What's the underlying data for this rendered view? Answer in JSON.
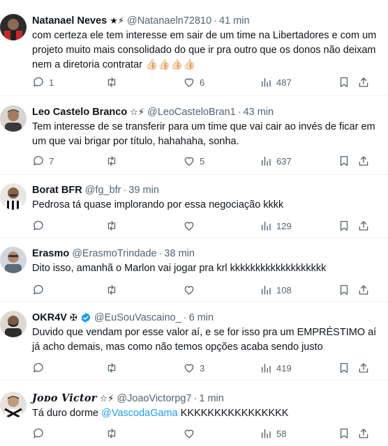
{
  "tweets": [
    {
      "name": "Natanael Neves",
      "decor": "★⚡",
      "handle": "@Natanaeln72810",
      "sep": "·",
      "time": "41 min",
      "text": "com certeza ele tem interesse em sair de um time na Libertadores e com um projeto muito mais consolidado do que ir pra outro que os donos não deixam nem a diretoria contratar 👍🏻👍🏻👍🏻👍🏻",
      "replies": "1",
      "retweets": "",
      "likes": "6",
      "views": "487"
    },
    {
      "name": "Leo Castelo Branco",
      "decor": "☆⚡",
      "handle": "@LeoCasteloBran1",
      "sep": "·",
      "time": "43 min",
      "text": "Tem interesse de se transferir para um time que vai cair ao invés de ficar em um que vai brigar por título, hahahaha, sonha.",
      "replies": "7",
      "retweets": "",
      "likes": "5",
      "views": "637"
    },
    {
      "name": "Borat BFR",
      "decor": "",
      "handle": "@fg_bfr",
      "sep": "·",
      "time": "39 min",
      "text": "Pedrosa tá quase implorando por essa negociação kkkk",
      "replies": "",
      "retweets": "",
      "likes": "",
      "views": "129"
    },
    {
      "name": "Erasmo",
      "decor": "",
      "handle": "@ErasmoTrindade",
      "sep": "·",
      "time": "38 min",
      "text": "Dito isso, amanhã o Marlon vai jogar pra krl kkkkkkkkkkkkkkkkkkk",
      "replies": "",
      "retweets": "",
      "likes": "",
      "views": "108"
    },
    {
      "name": "OKR4V",
      "decor": "✠",
      "handle": "@EuSouVascaino_",
      "sep": "·",
      "time": "6 min",
      "text": "Duvido que vendam por esse valor aí, e se for isso pra um EMPRÉSTIMO aí já acho demais, mas como não temos opções acaba sendo justo",
      "replies": "",
      "retweets": "",
      "likes": "3",
      "views": "419"
    },
    {
      "name": "Joᴅo Victor",
      "decor": "☆⚡",
      "handle": "@JoaoVictorpg7",
      "sep": "·",
      "time": "1 min",
      "text_before": "Tá duro dorme ",
      "mention": "@VascodaGama",
      "text_after": " KKKKKKKKKKKKKKKK",
      "replies": "",
      "retweets": "",
      "likes": "",
      "views": "58"
    }
  ],
  "colors": {
    "text": "#0f1419",
    "muted": "#536471",
    "link": "#1d9bf0",
    "verified": "#1d9bf0",
    "divider": "#eff3f4"
  }
}
